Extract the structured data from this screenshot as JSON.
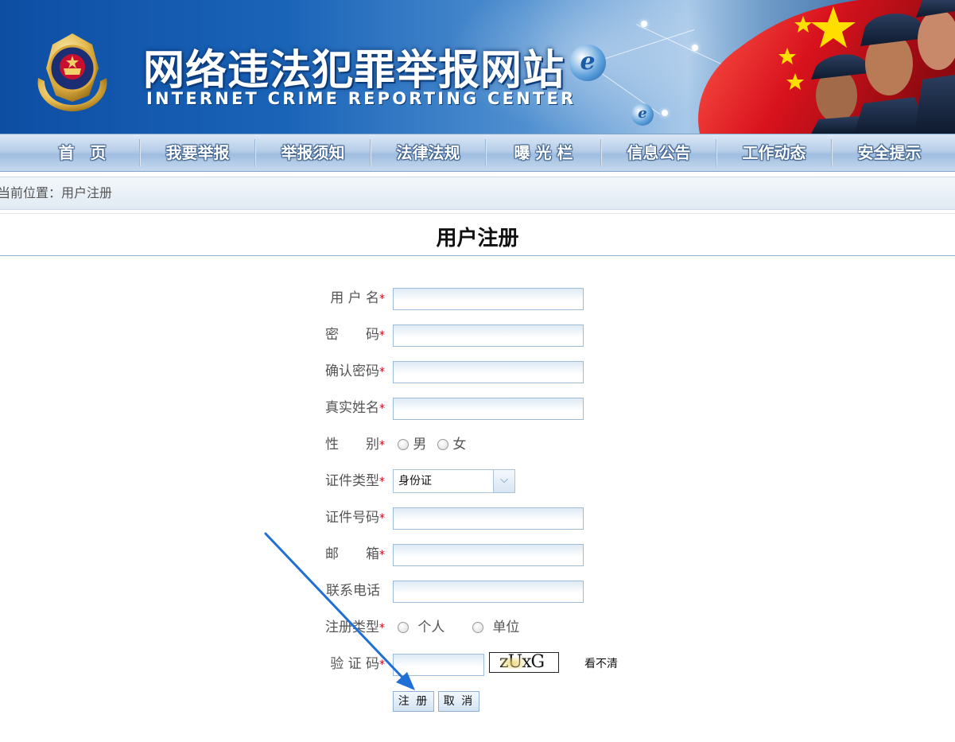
{
  "banner": {
    "title": "网络违法犯罪举报网站",
    "subtitle": "INTERNET CRIME REPORTING CENTER",
    "globe_letter": "e"
  },
  "nav": {
    "items": [
      {
        "label": "首　页"
      },
      {
        "label": "我要举报"
      },
      {
        "label": "举报须知"
      },
      {
        "label": "法律法规"
      },
      {
        "label": "曝 光 栏"
      },
      {
        "label": "信息公告"
      },
      {
        "label": "工作动态"
      },
      {
        "label": "安全提示"
      }
    ]
  },
  "breadcrumb": {
    "text": "当前位置：用户注册"
  },
  "page": {
    "title": "用户注册"
  },
  "form": {
    "required_mark": "*",
    "username": {
      "label": "用 户 名",
      "value": ""
    },
    "password": {
      "label": "密　　码",
      "value": ""
    },
    "confirm_password": {
      "label": "确认密码",
      "value": ""
    },
    "real_name": {
      "label": "真实姓名",
      "value": ""
    },
    "gender": {
      "label": "性　　别",
      "options": [
        "男",
        "女"
      ]
    },
    "id_type": {
      "label": "证件类型",
      "selected": "身份证"
    },
    "id_number": {
      "label": "证件号码",
      "value": ""
    },
    "email": {
      "label": "邮　　箱",
      "value": ""
    },
    "phone": {
      "label": "联系电话",
      "value": ""
    },
    "register_type": {
      "label": "注册类型",
      "options": [
        "个人",
        "单位"
      ]
    },
    "captcha": {
      "label": "验 证 码",
      "value": "",
      "image_text": "zUxG",
      "refresh_label": "看不清"
    },
    "submit_label": "注 册",
    "cancel_label": "取 消"
  },
  "colors": {
    "banner_blue": "#1a64b8",
    "required_red": "#d0021b",
    "annotation_arrow": "#1f6fd6"
  }
}
